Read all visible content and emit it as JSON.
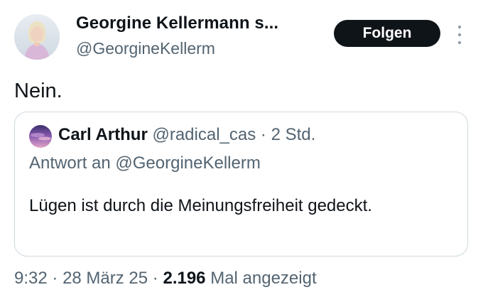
{
  "author": {
    "name": "Georgine Kellermann s...",
    "handle": "@GeorgineKellerm",
    "follow_label": "Folgen"
  },
  "tweet": {
    "text": "Nein."
  },
  "quoted": {
    "name": "Carl Arthur",
    "handle": "@radical_cas",
    "separator": "·",
    "time": "2 Std.",
    "reply_to": "Antwort an @GeorgineKellerm",
    "text": "Lügen ist durch die Meinungsfreiheit gedeckt."
  },
  "footer": {
    "time": "9:32",
    "date": "28 März 25",
    "sep1": "·",
    "sep2": "·",
    "views_count": "2.196",
    "views_label": "Mal angezeigt"
  },
  "colors": {
    "text_primary": "#0f1419",
    "text_secondary": "#536471",
    "border": "#cfd9de",
    "button_bg": "#0f1419",
    "button_text": "#ffffff"
  },
  "icons": {
    "more": "more-vertical-icon"
  }
}
